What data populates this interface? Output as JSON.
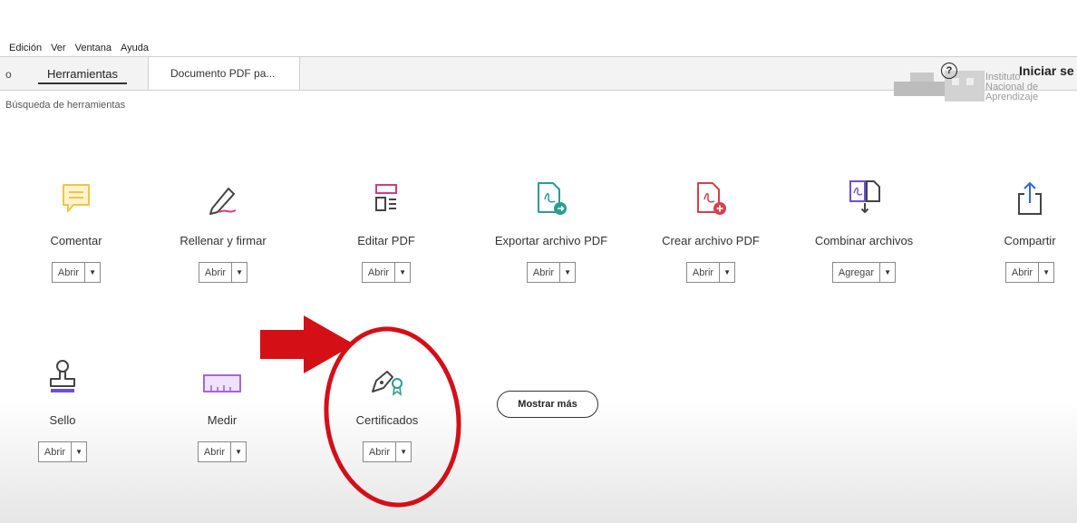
{
  "menu": [
    "Edición",
    "Ver",
    "Ventana",
    "Ayuda"
  ],
  "tabs": {
    "fragment": "o",
    "tools": "Herramientas",
    "document": "Documento PDF pa..."
  },
  "header": {
    "help_symbol": "?",
    "signin": "Iniciar se",
    "watermark_lines": [
      "Instituto",
      "Nacional de",
      "Aprendizaje"
    ]
  },
  "search_label": "Búsqueda de herramientas",
  "tools": [
    {
      "name": "Comentar",
      "action": "Abrir",
      "icon": "comment-icon"
    },
    {
      "name": "Rellenar y firmar",
      "action": "Abrir",
      "icon": "fill-sign-icon"
    },
    {
      "name": "Editar PDF",
      "action": "Abrir",
      "icon": "edit-pdf-icon"
    },
    {
      "name": "Exportar archivo PDF",
      "action": "Abrir",
      "icon": "export-pdf-icon"
    },
    {
      "name": "Crear archivo PDF",
      "action": "Abrir",
      "icon": "create-pdf-icon"
    },
    {
      "name": "Combinar archivos",
      "action": "Agregar",
      "icon": "combine-files-icon"
    },
    {
      "name": "Compartir",
      "action": "Abrir",
      "icon": "share-icon"
    },
    {
      "name": "Sello",
      "action": "Abrir",
      "icon": "stamp-icon"
    },
    {
      "name": "Medir",
      "action": "Abrir",
      "icon": "measure-icon"
    },
    {
      "name": "Certificados",
      "action": "Abrir",
      "icon": "certificates-icon"
    }
  ],
  "more_button": "Mostrar más",
  "colors": {
    "comment": "#f5c242",
    "edit": "#d63b7c",
    "export": "#2a9d8f",
    "create": "#d6404b",
    "combine": "#6b4fd8",
    "share": "#2f68d8",
    "measure": "#a767d4",
    "annotation": "#d40f16"
  }
}
